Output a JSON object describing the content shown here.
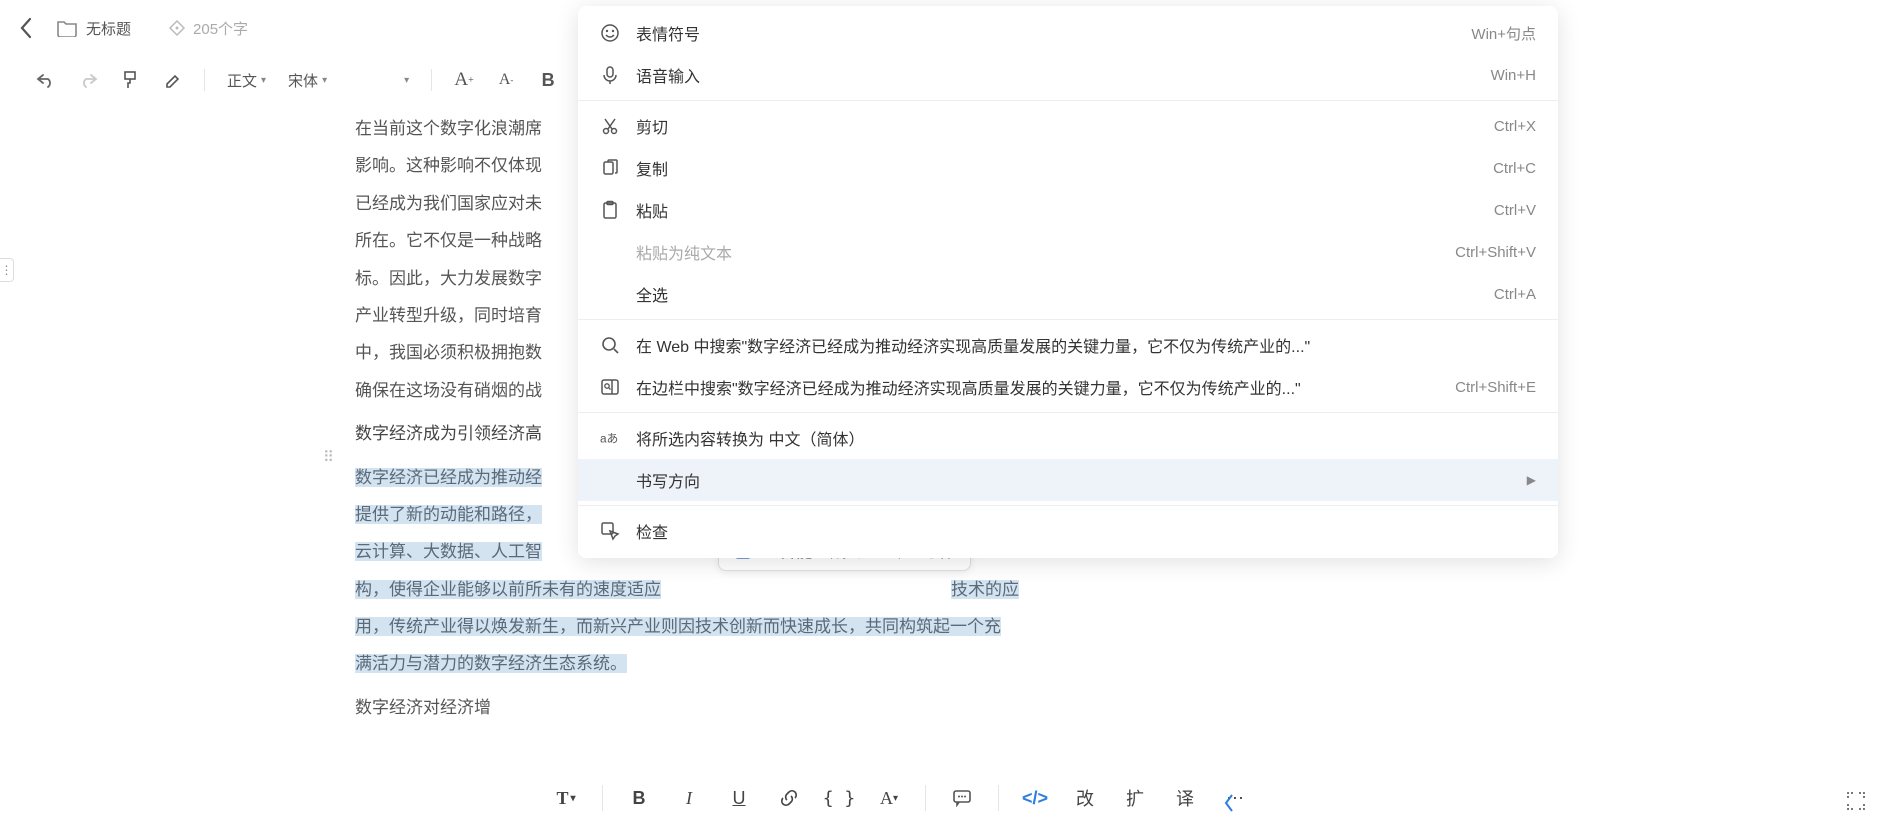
{
  "header": {
    "doc_title": "无标题",
    "word_count": "205个字"
  },
  "toolbar": {
    "style_label": "正文",
    "font_label": "宋体"
  },
  "content": {
    "para1": "在当前这个数字化浪潮席",
    "para1b": "影响。这种影响不仅体现",
    "para1c": "已经成为我们国家应对未",
    "para1d": "所在。它不仅是一种战略",
    "para1e": "标。因此，大力发展数字",
    "para1f": "产业转型升级，同时培育",
    "para1g": "中，我国必须积极拥抱数",
    "para1h": "确保在这场没有硝烟的战",
    "heading": "数字经济成为引领经济高",
    "sel1": "数字经济已经成为推动经",
    "sel2": "提供了新的动能和路径，",
    "sel3": "云计算、大数据、人工智",
    "sel4a": "构，使得企业能够以前所未有的速度适应",
    "sel4b": "技术的应",
    "sel5": "用，传统产业得以焕发新生，而新兴产业则因技术创新而快速成长，共同构筑起一个充",
    "sel6": "满活力与潜力的数字经济生态系统。",
    "para3": "数字经济对经济增"
  },
  "ai_popup": {
    "gen": "AI智能生成",
    "pro": "AI专业写作"
  },
  "bottom": {
    "gai": "改",
    "kuo": "扩",
    "yi": "译"
  },
  "context_menu": {
    "items": [
      {
        "icon": "emoji",
        "label": "表情符号",
        "shortcut": "Win+句点"
      },
      {
        "icon": "mic",
        "label": "语音输入",
        "shortcut": "Win+H"
      },
      {
        "sep": true
      },
      {
        "icon": "cut",
        "label": "剪切",
        "shortcut": "Ctrl+X"
      },
      {
        "icon": "copy",
        "label": "复制",
        "shortcut": "Ctrl+C"
      },
      {
        "icon": "paste",
        "label": "粘贴",
        "shortcut": "Ctrl+V"
      },
      {
        "icon": "",
        "label": "粘贴为纯文本",
        "shortcut": "Ctrl+Shift+V",
        "disabled": true
      },
      {
        "icon": "",
        "label": "全选",
        "shortcut": "Ctrl+A"
      },
      {
        "sep": true
      },
      {
        "icon": "search",
        "label": "在 Web 中搜索\"数字经济已经成为推动经济实现高质量发展的关键力量，它不仅为传统产业的...\"",
        "shortcut": ""
      },
      {
        "icon": "sidebar-search",
        "label": "在边栏中搜索\"数字经济已经成为推动经济实现高质量发展的关键力量，它不仅为传统产业的...\"",
        "shortcut": "Ctrl+Shift+E"
      },
      {
        "sep": true
      },
      {
        "icon": "translate",
        "label": "将所选内容转换为 中文（简体）",
        "shortcut": ""
      },
      {
        "icon": "",
        "label": "书写方向",
        "shortcut": "",
        "submenu": true,
        "hovered": true
      },
      {
        "sep": true
      },
      {
        "icon": "inspect",
        "label": "检查",
        "shortcut": ""
      }
    ]
  }
}
